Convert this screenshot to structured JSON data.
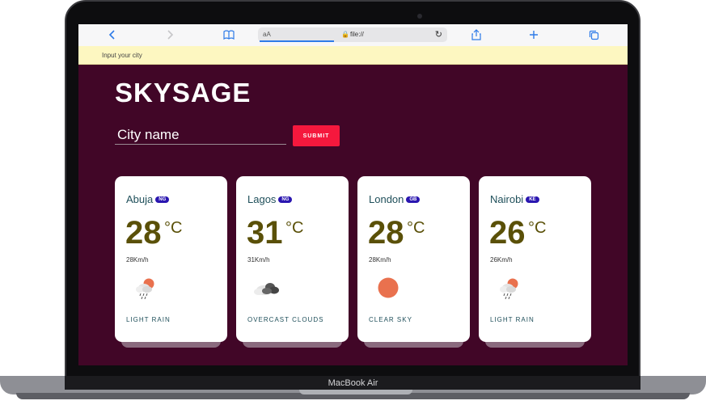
{
  "browser": {
    "url_prefix": "aA",
    "url": "file://",
    "icons": [
      "back-icon",
      "forward-icon",
      "bookmarks-icon",
      "lock-icon",
      "reload-icon",
      "share-icon",
      "new-tab-icon",
      "tabs-icon"
    ]
  },
  "tooltip": {
    "text": "Input your city"
  },
  "app": {
    "title": "SKYSAGE",
    "input_placeholder": "City name",
    "submit_label": "SUBMIT",
    "accent": "#f5183d",
    "background": "#410627"
  },
  "cards": [
    {
      "city": "Abuja",
      "country": "NG",
      "temp": "28",
      "unit": "°C",
      "wind": "28Km/h",
      "icon": "light-rain-icon",
      "desc": "LIGHT RAIN"
    },
    {
      "city": "Lagos",
      "country": "NG",
      "temp": "31",
      "unit": "°C",
      "wind": "31Km/h",
      "icon": "overcast-clouds-icon",
      "desc": "OVERCAST CLOUDS"
    },
    {
      "city": "London",
      "country": "GB",
      "temp": "28",
      "unit": "°C",
      "wind": "28Km/h",
      "icon": "clear-sky-icon",
      "desc": "CLEAR SKY"
    },
    {
      "city": "Nairobi",
      "country": "KE",
      "temp": "26",
      "unit": "°C",
      "wind": "26Km/h",
      "icon": "light-rain-icon",
      "desc": "LIGHT RAIN"
    }
  ],
  "device": {
    "label": "MacBook Air"
  }
}
